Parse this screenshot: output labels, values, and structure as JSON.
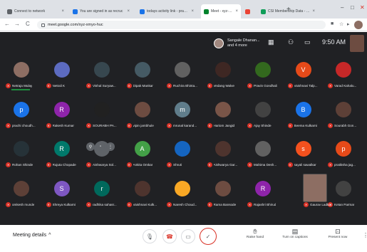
{
  "browser": {
    "tabs": [
      {
        "title": "Connect to network",
        "favicon": "#5f6368",
        "active": false
      },
      {
        "title": "You are signed in as recruc",
        "favicon": "#1a73e8",
        "active": false
      },
      {
        "title": "todays activity link - pradhyum",
        "favicon": "#1a73e8",
        "active": false
      },
      {
        "title": "Meet - xyz-xmyo-huc",
        "favicon": "#00832d",
        "active": true
      },
      {
        "title": "",
        "favicon": "#ea4335",
        "active": false
      },
      {
        "title": "CSI Membership Data - Google",
        "favicon": "#0f9d58",
        "active": false
      }
    ],
    "new_tab": "+",
    "window_controls": [
      "–",
      "□",
      "✕"
    ],
    "url": "meet.google.com/xyz-xmyo-huc",
    "nav": [
      "←",
      "→",
      "C"
    ]
  },
  "meet": {
    "header": {
      "names_line1": "Sangale Dhanan...",
      "names_line2": "and 4 more",
      "time": "9:50 AM",
      "icons": [
        "grid-icon",
        "people-icon",
        "chat-icon"
      ]
    },
    "participants": [
      {
        "name": "Netraja Mulay",
        "color": "#8d6e63",
        "initial": ""
      },
      {
        "name": "Netrali K",
        "color": "#5c6bc0",
        "initial": ""
      },
      {
        "name": "Vishal Suryaw...",
        "color": "#37474f",
        "initial": ""
      },
      {
        "name": "Dipak Mankar",
        "color": "#455a64",
        "initial": ""
      },
      {
        "name": "Ruchira Bhinta...",
        "color": "#616161",
        "initial": ""
      },
      {
        "name": "Vedang Walve",
        "color": "#3e2723",
        "initial": ""
      },
      {
        "name": "Pravin Gondhali",
        "color": "#33691e",
        "initial": ""
      },
      {
        "name": "Vaishnavi Talp...",
        "color": "#e64a19",
        "initial": "V"
      },
      {
        "name": "Varad Kahalu...",
        "color": "#c62828",
        "initial": ""
      },
      {
        "name": "prachi choudh...",
        "color": "#1a73e8",
        "initial": "p"
      },
      {
        "name": "Rakesh Kumar",
        "color": "#8e24aa",
        "initial": "R"
      },
      {
        "name": "SOURABH PA...",
        "color": "#212121",
        "initial": ""
      },
      {
        "name": "vipin jambhule",
        "color": "#6d4c41",
        "initial": ""
      },
      {
        "name": "mrunal karand...",
        "color": "#607d8b",
        "initial": "m"
      },
      {
        "name": "Hariom Jangid",
        "color": "#795548",
        "initial": ""
      },
      {
        "name": "Ajay Shinde",
        "color": "#424242",
        "initial": ""
      },
      {
        "name": "Beema Kulkarni",
        "color": "#1a73e8",
        "initial": "B"
      },
      {
        "name": "Sourabh Gon...",
        "color": "#5d4037",
        "initial": ""
      },
      {
        "name": "Rohan Shinde",
        "color": "#263238",
        "initial": ""
      },
      {
        "name": "Rujuta Chopade",
        "color": "#00796b",
        "initial": "R"
      },
      {
        "name": "Aishwarya Sol...",
        "color": "#5f6368",
        "initial": ""
      },
      {
        "name": "Ankita Omkar",
        "color": "#43a047",
        "initial": "A"
      },
      {
        "name": "Shruti",
        "color": "#1565c0",
        "initial": ""
      },
      {
        "name": "Aishwarya Gar...",
        "color": "#4e342e",
        "initial": ""
      },
      {
        "name": "Mahima Desh...",
        "color": "#616161",
        "initial": ""
      },
      {
        "name": "sayali sawalkar",
        "color": "#f4511e",
        "initial": "s"
      },
      {
        "name": "pratiksha jag...",
        "color": "#e64a19",
        "initial": "p"
      },
      {
        "name": "omkesh munde",
        "color": "#5d4037",
        "initial": ""
      },
      {
        "name": "Shreya Kulkarni",
        "color": "#7e57c2",
        "initial": "S"
      },
      {
        "name": "radhika sahasr...",
        "color": "#00695c",
        "initial": "r"
      },
      {
        "name": "Vaishnavi Kulk...",
        "color": "#4e342e",
        "initial": ""
      },
      {
        "name": "Naresh Choud...",
        "color": "#f9a825",
        "initial": ""
      },
      {
        "name": "Rama Bansode",
        "color": "#6d4c41",
        "initial": ""
      },
      {
        "name": "Rajashri Bhirud",
        "color": "#8e24aa",
        "initial": "R"
      },
      {
        "name": "Gaurav Ladkat",
        "color": "#8d6e63",
        "initial": ""
      },
      {
        "name": "Ketan Parmar",
        "color": "#424242",
        "initial": ""
      }
    ]
  },
  "controls": {
    "meeting_details": "Meeting details",
    "chevron": "^",
    "raise_hand": "Raise hand",
    "captions": "Turn on captions",
    "present": "Present now",
    "more": "⋮"
  },
  "colors": {
    "meet_bg": "#202124",
    "mic_off": "#d93025",
    "speaking": "#1e8e3e"
  }
}
